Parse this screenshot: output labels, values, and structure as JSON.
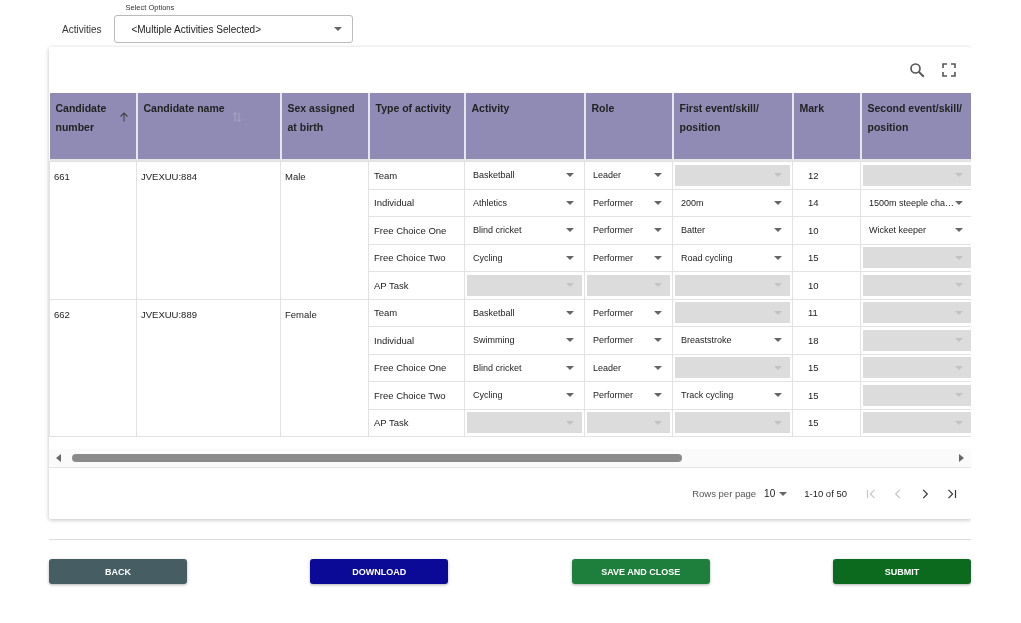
{
  "filter": {
    "label": "Activities",
    "legend": "Select Options",
    "value": "<Multiple Activities Selected>"
  },
  "toolbar": {
    "icons": [
      {
        "kind": "search"
      },
      {
        "kind": "fullscreen"
      }
    ]
  },
  "table": {
    "columns": [
      {
        "label": "Candidate number",
        "sortable": true,
        "sorted": true
      },
      {
        "label": "Candidate name",
        "sortable": true,
        "sorted": false
      },
      {
        "label": "Sex assigned at birth"
      },
      {
        "label": "Type of activity"
      },
      {
        "label": "Activity"
      },
      {
        "label": "Role"
      },
      {
        "label": "First event/skill/ position"
      },
      {
        "label": "Mark"
      },
      {
        "label": "Second event/skill/ position"
      }
    ],
    "candidates": [
      {
        "number": "661",
        "name": "JVEXUU:884",
        "sex": "Male",
        "activities": [
          {
            "type": "Team",
            "activity": {
              "value": "Basketball",
              "disabled": false
            },
            "role": {
              "value": "Leader",
              "disabled": false
            },
            "first": {
              "disabled": true
            },
            "mark": "12",
            "second": {
              "disabled": true
            }
          },
          {
            "type": "Individual",
            "activity": {
              "value": "Athletics",
              "disabled": false
            },
            "role": {
              "value": "Performer",
              "disabled": false
            },
            "first": {
              "value": "200m",
              "disabled": false
            },
            "mark": "14",
            "second": {
              "value": "1500m steeple cha…",
              "disabled": false
            }
          },
          {
            "type": "Free Choice One",
            "activity": {
              "value": "Blind cricket",
              "disabled": false
            },
            "role": {
              "value": "Performer",
              "disabled": false
            },
            "first": {
              "value": "Batter",
              "disabled": false
            },
            "mark": "10",
            "second": {
              "value": "Wicket keeper",
              "disabled": false
            }
          },
          {
            "type": "Free Choice Two",
            "activity": {
              "value": "Cycling",
              "disabled": false
            },
            "role": {
              "value": "Performer",
              "disabled": false
            },
            "first": {
              "value": "Road cycling",
              "disabled": false
            },
            "mark": "15",
            "second": {
              "disabled": true
            }
          },
          {
            "type": "AP Task",
            "activity": {
              "disabled": true
            },
            "role": {
              "disabled": true
            },
            "first": {
              "disabled": true
            },
            "mark": "10",
            "second": {
              "disabled": true
            }
          }
        ]
      },
      {
        "number": "662",
        "name": "JVEXUU:889",
        "sex": "Female",
        "activities": [
          {
            "type": "Team",
            "activity": {
              "value": "Basketball",
              "disabled": false
            },
            "role": {
              "value": "Performer",
              "disabled": false
            },
            "first": {
              "disabled": true
            },
            "mark": "11",
            "second": {
              "disabled": true
            }
          },
          {
            "type": "Individual",
            "activity": {
              "value": "Swimming",
              "disabled": false
            },
            "role": {
              "value": "Performer",
              "disabled": false
            },
            "first": {
              "value": "Breaststroke",
              "disabled": false
            },
            "mark": "18",
            "second": {
              "disabled": true
            }
          },
          {
            "type": "Free Choice One",
            "activity": {
              "value": "Blind cricket",
              "disabled": false
            },
            "role": {
              "value": "Leader",
              "disabled": false
            },
            "first": {
              "disabled": true
            },
            "mark": "15",
            "second": {
              "disabled": true
            }
          },
          {
            "type": "Free Choice Two",
            "activity": {
              "value": "Cycling",
              "disabled": false
            },
            "role": {
              "value": "Performer",
              "disabled": false
            },
            "first": {
              "value": "Track cycling",
              "disabled": false
            },
            "mark": "15",
            "second": {
              "disabled": true
            }
          },
          {
            "type": "AP Task",
            "activity": {
              "disabled": true
            },
            "role": {
              "disabled": true
            },
            "first": {
              "disabled": true
            },
            "mark": "15",
            "second": {
              "disabled": true
            }
          }
        ]
      }
    ]
  },
  "pagination": {
    "rows_label": "Rows per page",
    "rows_value": "10",
    "range": "1-10 of 50",
    "nav": [
      {
        "kind": "first",
        "disabled": true
      },
      {
        "kind": "prev",
        "disabled": true
      },
      {
        "kind": "next",
        "disabled": false
      },
      {
        "kind": "last",
        "disabled": false
      }
    ]
  },
  "buttons": [
    {
      "label": "BACK",
      "color": "#455d63"
    },
    {
      "label": "DOWNLOAD",
      "color": "#0a0a96"
    },
    {
      "label": "SAVE AND CLOSE",
      "color": "#1e7f3c"
    },
    {
      "label": "SUBMIT",
      "color": "#0b6a1d"
    }
  ]
}
